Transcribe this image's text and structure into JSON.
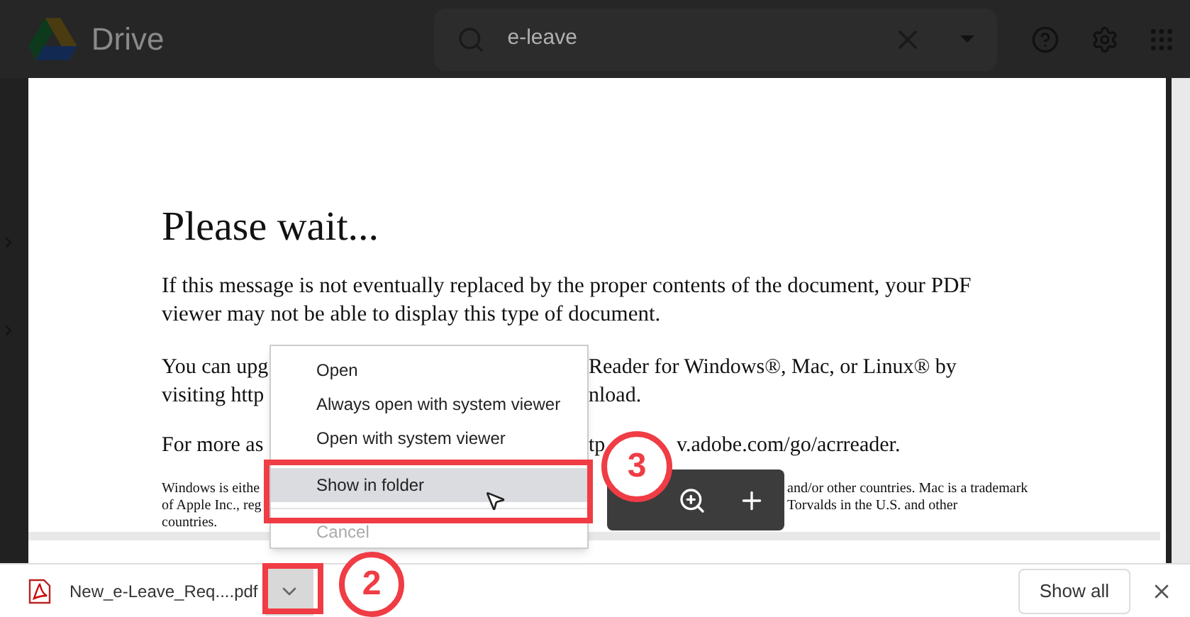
{
  "header": {
    "app_name": "Drive",
    "search": {
      "value": "e-leave"
    }
  },
  "document": {
    "title": "Please wait...",
    "paragraph": "If this message is not eventually replaced by the proper contents of the document, your PDF viewer may not be able to display this type of document.",
    "partial_lines": [
      {
        "left": "You can upg",
        "right": "Reader for Windows®, Mac, or Linux® by"
      },
      {
        "left": "visiting  http",
        "right": "nload."
      }
    ],
    "more_line": {
      "left": "For more as",
      "middle": "tp",
      "right": "v.adobe.com/go/acrreader."
    },
    "footnote_lines": [
      {
        "left": "Windows is eithe",
        "right": "and/or other countries. Mac is a trademark"
      },
      {
        "left": "of Apple Inc., reg",
        "right": "Torvalds in the U.S. and other"
      },
      {
        "left": "countries."
      }
    ]
  },
  "context_menu": {
    "items": [
      {
        "label": "Open",
        "selected": false,
        "disabled": false,
        "separator_before": false
      },
      {
        "label": "Always open with system viewer",
        "selected": false,
        "disabled": false,
        "separator_before": false
      },
      {
        "label": "Open with system viewer",
        "selected": false,
        "disabled": false,
        "separator_before": false
      },
      {
        "label": "Show in folder",
        "selected": true,
        "disabled": false,
        "separator_before": true
      },
      {
        "label": "Cancel",
        "selected": false,
        "disabled": true,
        "separator_before": true
      }
    ]
  },
  "download_bar": {
    "file_name": "New_e-Leave_Req....pdf",
    "show_all": "Show all"
  },
  "callouts": [
    {
      "number": "3"
    },
    {
      "number": "2"
    }
  ]
}
